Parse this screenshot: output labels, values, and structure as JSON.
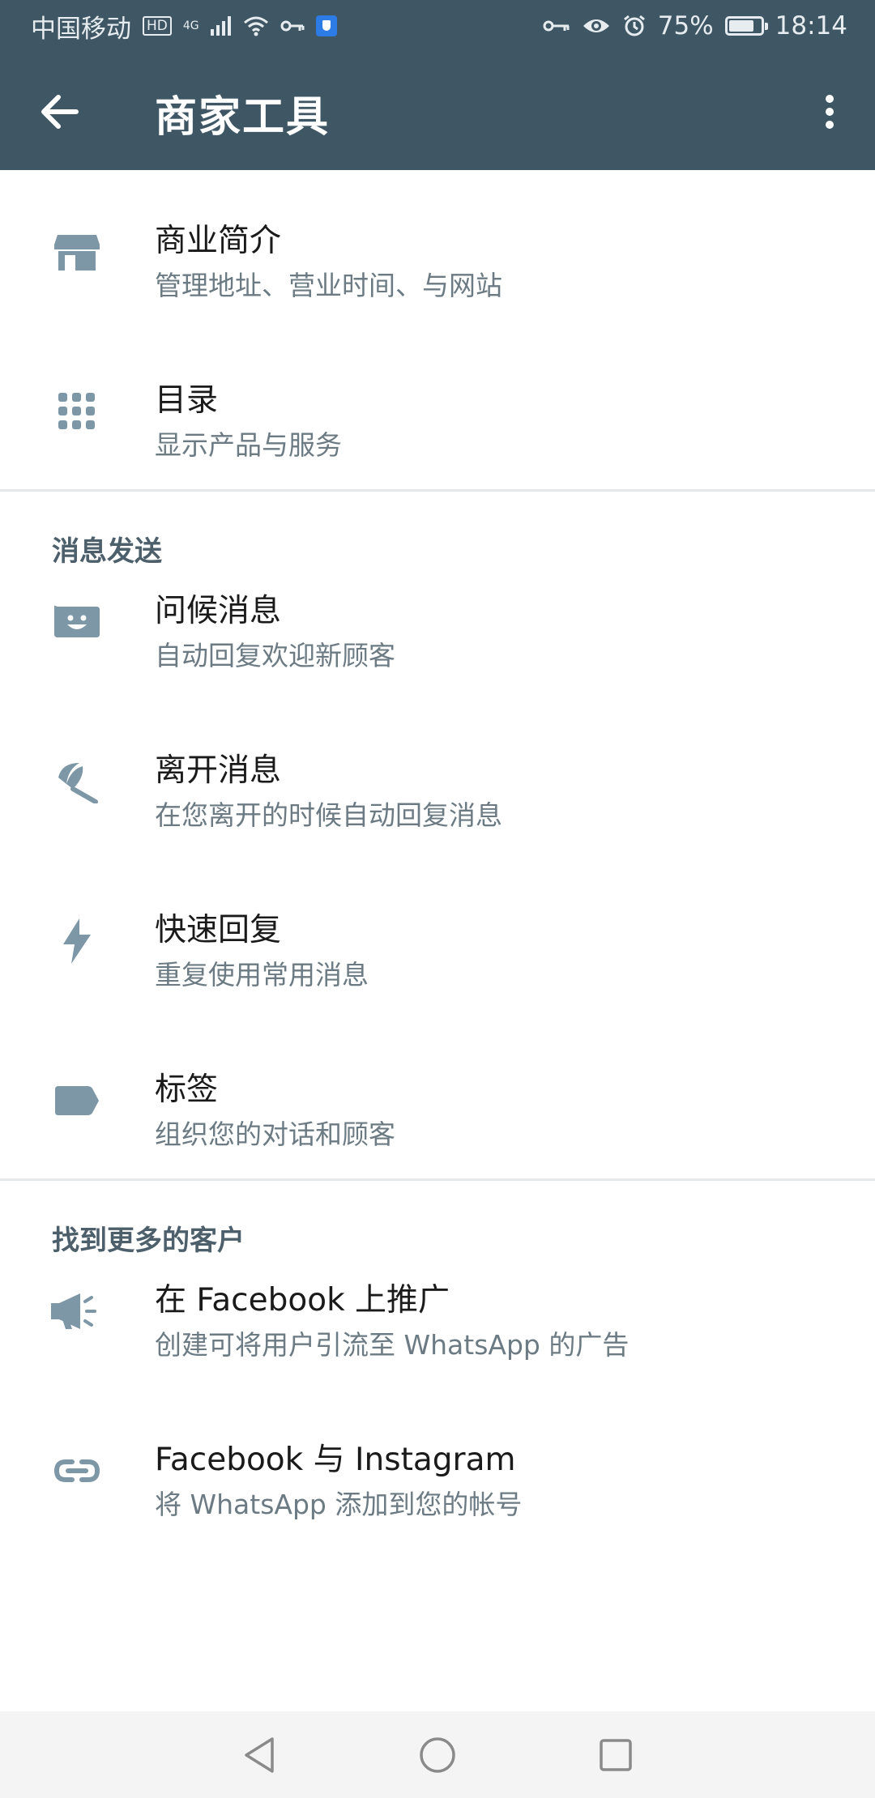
{
  "status_bar": {
    "carrier": "中国移动",
    "hd": "HD",
    "network": "4G",
    "battery": "75%",
    "time": "18:14"
  },
  "toolbar": {
    "title": "商家工具"
  },
  "top_items": [
    {
      "icon": "storefront-icon",
      "title": "商业简介",
      "subtitle": "管理地址、营业时间、与网站"
    },
    {
      "icon": "grid-icon",
      "title": "目录",
      "subtitle": "显示产品与服务"
    }
  ],
  "sections": [
    {
      "header": "消息发送",
      "items": [
        {
          "icon": "greeting-icon",
          "title": "问候消息",
          "subtitle": "自动回复欢迎新顾客"
        },
        {
          "icon": "beach-umbrella-icon",
          "title": "离开消息",
          "subtitle": "在您离开的时候自动回复消息"
        },
        {
          "icon": "lightning-icon",
          "title": "快速回复",
          "subtitle": "重复使用常用消息"
        },
        {
          "icon": "label-icon",
          "title": "标签",
          "subtitle": "组织您的对话和顾客"
        }
      ]
    },
    {
      "header": "找到更多的客户",
      "items": [
        {
          "icon": "megaphone-icon",
          "title": "在 Facebook 上推广",
          "subtitle": "创建可将用户引流至 WhatsApp 的广告"
        },
        {
          "icon": "link-icon",
          "title": "Facebook 与 Instagram",
          "subtitle": "将 WhatsApp 添加到您的帐号"
        }
      ]
    }
  ],
  "colors": {
    "toolbar": "#3f5764",
    "icon": "#7d97a6",
    "subtitle": "#6c7b83"
  }
}
